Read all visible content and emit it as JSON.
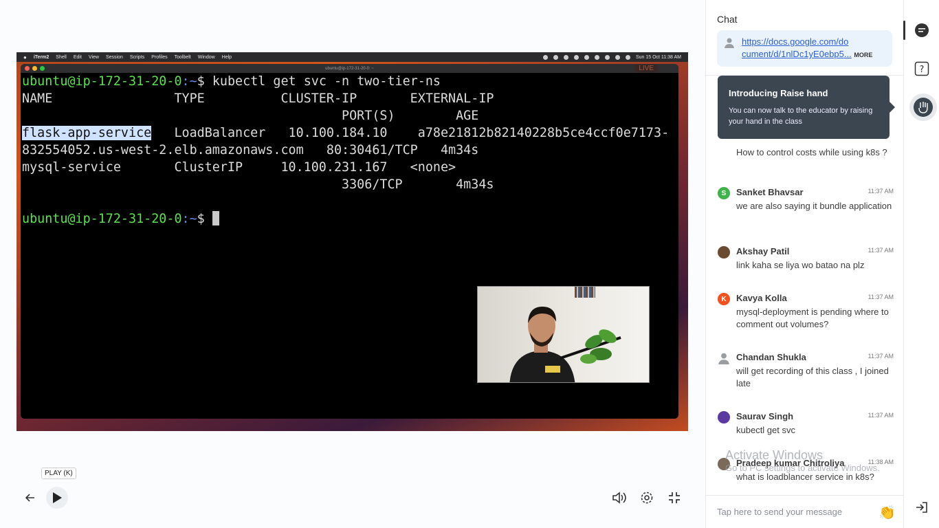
{
  "mac_menubar": {
    "items": [
      "iTerm2",
      "Shell",
      "Edit",
      "View",
      "Session",
      "Scripts",
      "Profiles",
      "Toolbelt",
      "Window",
      "Help"
    ],
    "clock": "Sun 15 Oct 11:38 AM"
  },
  "terminal": {
    "title": "ubuntu@ip-172-31-20-0: ~",
    "live_badge": "LIVE",
    "prompt_user": "ubuntu@ip-172-31-20-0",
    "prompt_path": ":~",
    "prompt_sym": "$ ",
    "command": "kubectl get svc -n two-tier-ns",
    "header_line1": "NAME                TYPE          CLUSTER-IP       EXTERNAL-IP",
    "header_line2": "                                          PORT(S)        AGE",
    "row1_name": "flask-app-service",
    "row1_rest": "   LoadBalancer   10.100.184.10    a78e21812b82140228b5ce4ccf0e7173-",
    "row1_line2": "832554052.us-west-2.elb.amazonaws.com   80:30461/TCP   4m34s",
    "row2_line1": "mysql-service       ClusterIP     10.100.231.167   <none>",
    "row2_line2": "                                          3306/TCP       4m34s"
  },
  "controls": {
    "play_tooltip": "PLAY (K)"
  },
  "chat": {
    "title": "Chat",
    "pinned_link": "https://docs.google.com/document/d/1nlDc1yE0ebp5",
    "pinned_link_line1": "https://docs.google.com/do",
    "pinned_link_line2": "cument/d/1nlDc1yE0ebp5",
    "pinned_ellipsis": "...",
    "pinned_more": "MORE",
    "popup_title": "Introducing Raise hand",
    "popup_text": "You can now talk to the educator by raising your hand in the class",
    "messages": [
      {
        "name": "",
        "initial": "",
        "time": "",
        "text": "How to control costs while using k8s ?",
        "color": "#999999"
      },
      {
        "name": "Sanket Bhavsar",
        "initial": "S",
        "time": "11:37 AM",
        "text": "we are also saying it bundle application",
        "color": "#3fb24a"
      },
      {
        "name": "Akshay Patil",
        "initial": "",
        "time": "11:37 AM",
        "text": "link kaha se liya wo batao na plz",
        "color": "#6b4a32"
      },
      {
        "name": "Kavya Kolla",
        "initial": "K",
        "time": "11:37 AM",
        "text": "mysql-deployment is pending where to comment out volumes?",
        "color": "#f4511e"
      },
      {
        "name": "Chandan Shukla",
        "initial": "",
        "time": "11:37 AM",
        "text": "will get recording of this class , I joined late",
        "color": "#b0b4b8"
      },
      {
        "name": "Saurav Singh",
        "initial": "",
        "time": "11:37 AM",
        "text": "kubectl get svc",
        "color": "#5b3aa0"
      },
      {
        "name": "Pradeep kumar Chitroliya",
        "initial": "",
        "time": "11:38 AM",
        "text": "what is loadblancer service in k8s?",
        "color": "#7a6a5a"
      }
    ],
    "compose_placeholder": "Tap here to send your message",
    "watermark_line1": "Activate Windows",
    "watermark_line2": "Go to PC settings to activate Windows."
  }
}
